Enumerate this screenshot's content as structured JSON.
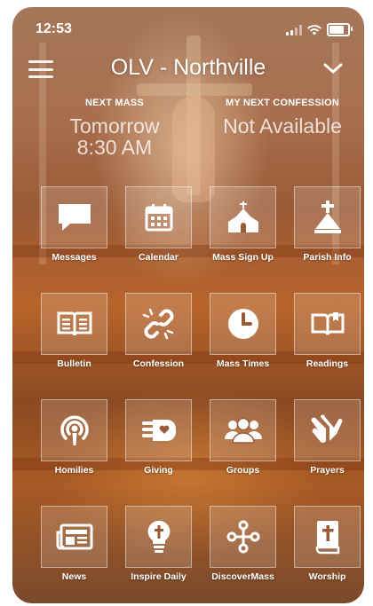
{
  "status_bar": {
    "time": "12:53"
  },
  "header": {
    "title": "OLV - Northville"
  },
  "next_mass": {
    "label": "NEXT MASS",
    "line1": "Tomorrow",
    "line2": "8:30 AM"
  },
  "next_confession": {
    "label": "MY NEXT CONFESSION",
    "value": "Not Available"
  },
  "tiles": [
    {
      "label": "Messages",
      "icon": "message-bubble-icon"
    },
    {
      "label": "Calendar",
      "icon": "calendar-icon"
    },
    {
      "label": "Mass Sign Up",
      "icon": "church-icon"
    },
    {
      "label": "Parish Info",
      "icon": "parish-info-icon"
    },
    {
      "label": "Bulletin",
      "icon": "bulletin-book-icon"
    },
    {
      "label": "Confession",
      "icon": "broken-chain-icon"
    },
    {
      "label": "Mass Times",
      "icon": "clock-icon"
    },
    {
      "label": "Readings",
      "icon": "open-book-icon"
    },
    {
      "label": "Homilies",
      "icon": "podcast-icon"
    },
    {
      "label": "Giving",
      "icon": "giving-hand-icon"
    },
    {
      "label": "Groups",
      "icon": "groups-icon"
    },
    {
      "label": "Prayers",
      "icon": "praying-hands-icon"
    },
    {
      "label": "News",
      "icon": "newspaper-icon"
    },
    {
      "label": "Inspire Daily",
      "icon": "lightbulb-cross-icon"
    },
    {
      "label": "DiscoverMass",
      "icon": "discover-mass-icon"
    },
    {
      "label": "Worship",
      "icon": "bible-icon"
    }
  ]
}
